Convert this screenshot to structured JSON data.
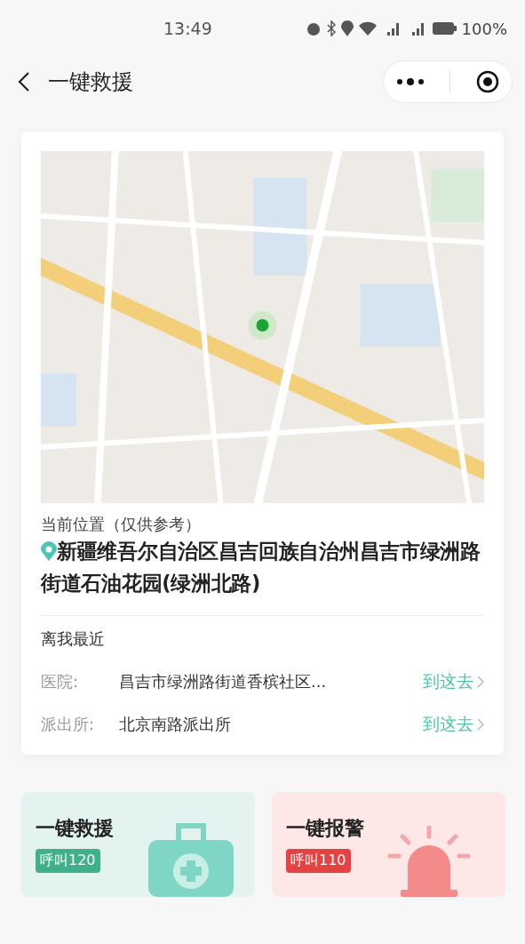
{
  "status_bar": {
    "time": "13:49",
    "battery": "100%"
  },
  "nav": {
    "title": "一键救援"
  },
  "location": {
    "label": "当前位置（仅供参考）",
    "address": "新疆维吾尔自治区昌吉回族自治州昌吉市绿洲路街道石油花园(绿洲北路)"
  },
  "nearby": {
    "title": "离我最近",
    "items": [
      {
        "label": "医院:",
        "name": "昌吉市绿洲路街道香槟社区...",
        "action": "到这去"
      },
      {
        "label": "派出所:",
        "name": "北京南路派出所",
        "action": "到这去"
      }
    ]
  },
  "actions": [
    {
      "kind": "rescue",
      "title": "一键救援",
      "badge": "呼叫120"
    },
    {
      "kind": "police",
      "title": "一键报警",
      "badge": "呼叫110"
    }
  ]
}
